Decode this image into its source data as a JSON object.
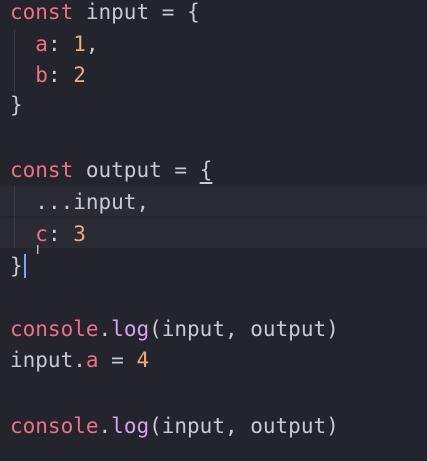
{
  "code": {
    "l1": {
      "kw": "const",
      "name": "input",
      "eq": "=",
      "brace": "{"
    },
    "l2": {
      "prop": "a",
      "sep": ": ",
      "num": "1",
      "comma": ","
    },
    "l3": {
      "prop": "b",
      "sep": ": ",
      "num": "2"
    },
    "l4": {
      "brace": "}"
    },
    "l5": {
      "kw": "const",
      "name": "output",
      "eq": "=",
      "brace": "{"
    },
    "l6": {
      "text": "...input,"
    },
    "l7": {
      "prop": "c",
      "sep": ": ",
      "num": "3"
    },
    "l8": {
      "brace": "}"
    },
    "l9": {
      "obj": "console",
      "dot": ".",
      "fn": "log",
      "args": "(input, output)"
    },
    "l10": {
      "obj": "input",
      "dot": ".",
      "prop": "a",
      "eq": " = ",
      "num": "4"
    },
    "l11": {
      "obj": "console",
      "dot": ".",
      "fn": "log",
      "args": "(input, output)"
    }
  },
  "cursor": {
    "glyph": "I"
  },
  "colors": {
    "background": "#24242c",
    "keyword": "#ee6f86",
    "number": "#f2a97a",
    "function": "#d6a2f0",
    "text": "#c9c9d1"
  }
}
